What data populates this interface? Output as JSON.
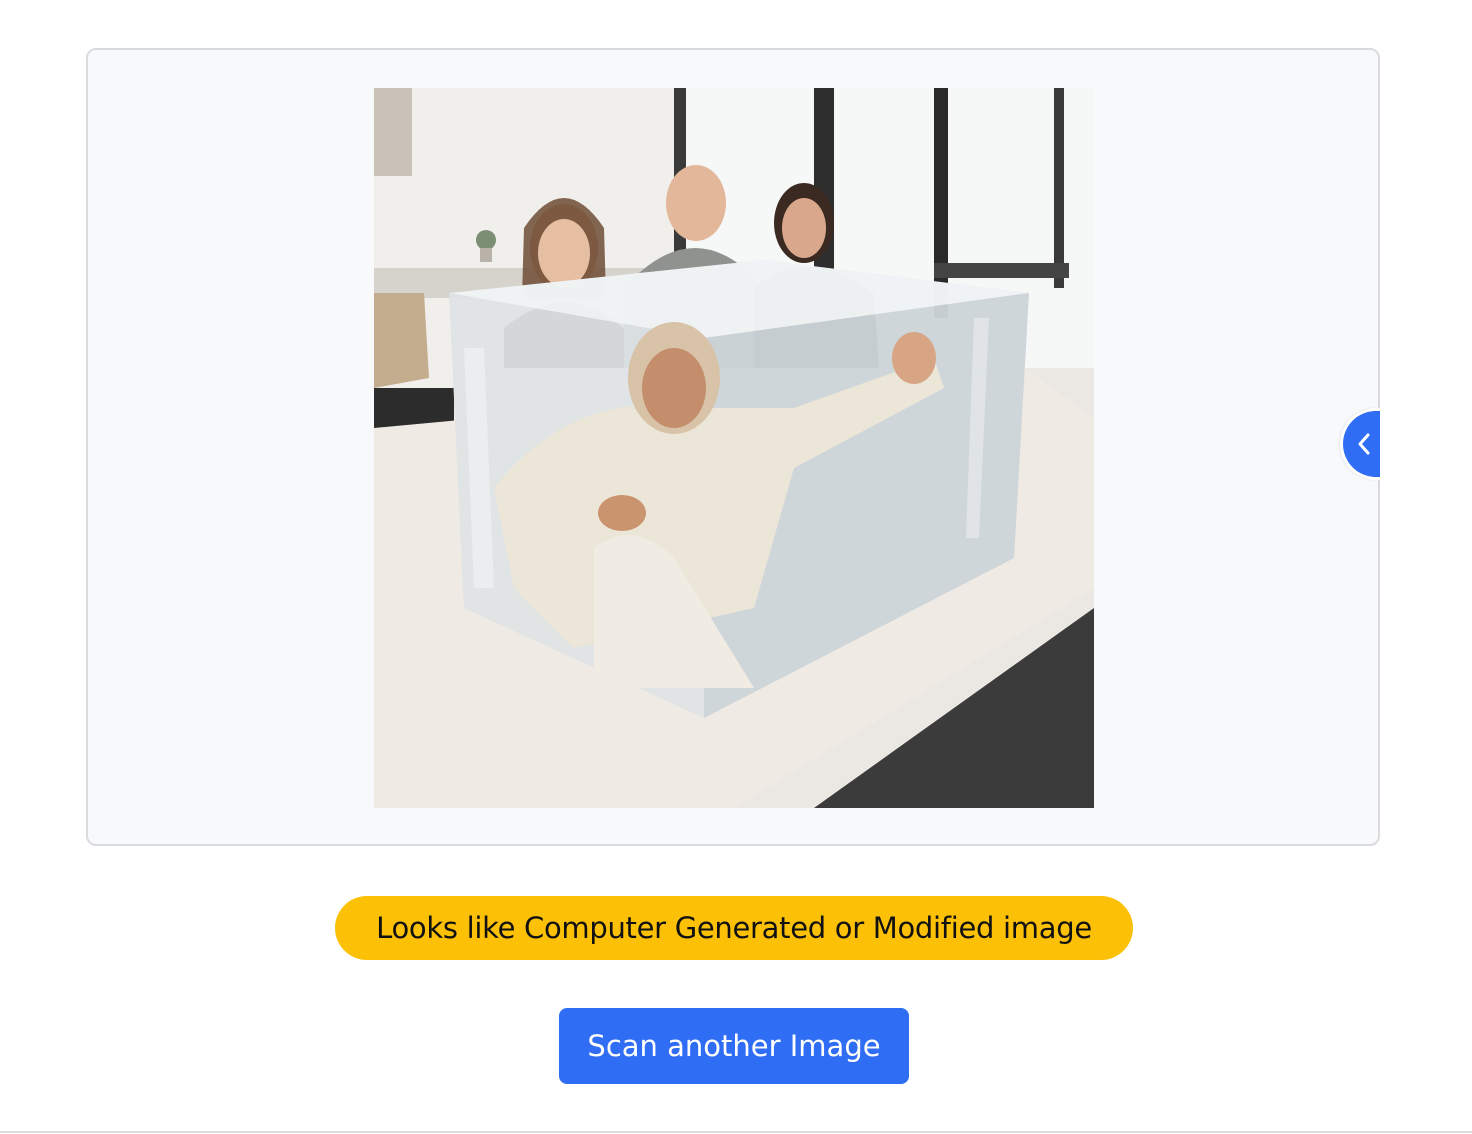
{
  "preview": {
    "image_alt": "Uploaded photo: people behind a transparent block of ice containing a figure on an office table",
    "collapse_icon": "chevron-left-icon"
  },
  "result": {
    "verdict": "Looks like Computer Generated or Modified image",
    "verdict_color": "#fcc006"
  },
  "actions": {
    "scan_another_label": "Scan another Image",
    "button_color": "#2f6df4"
  }
}
